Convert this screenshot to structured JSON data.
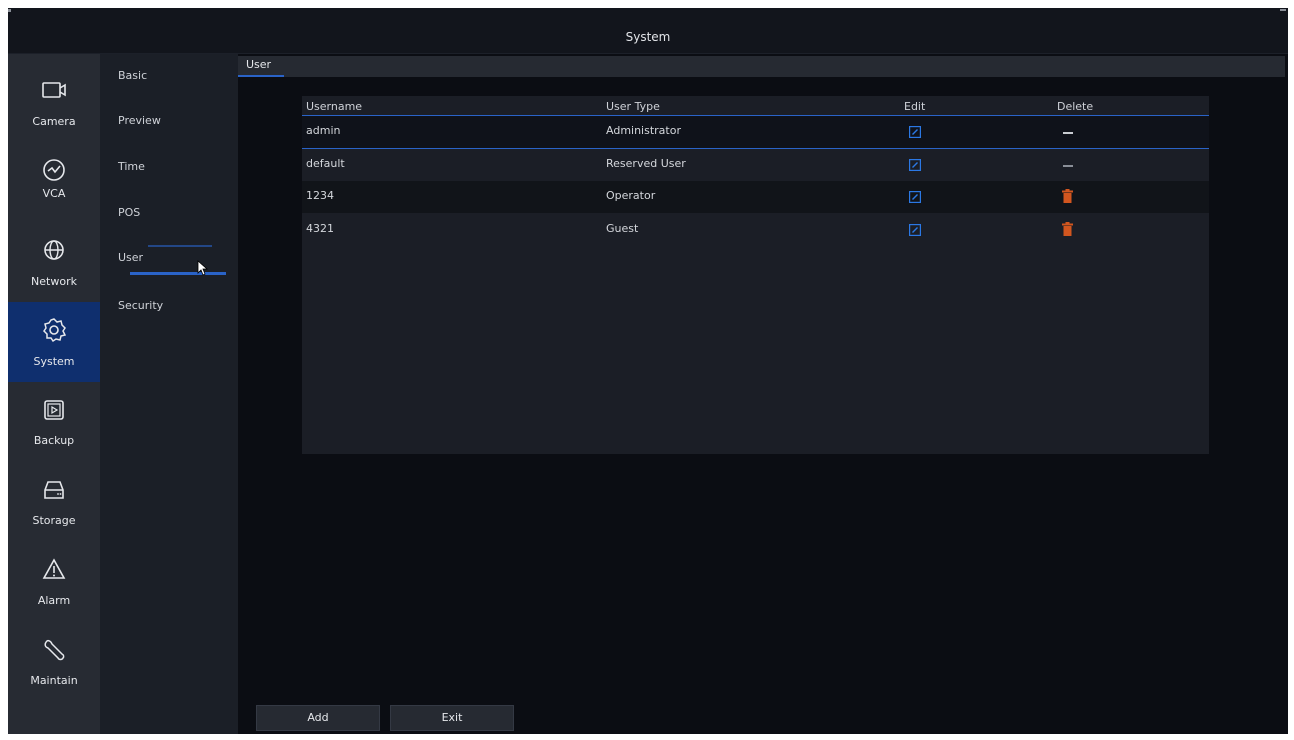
{
  "window": {
    "title": "System"
  },
  "nav": [
    {
      "label": "Camera",
      "icon": "camera-icon"
    },
    {
      "label": "VCA",
      "icon": "vca-icon"
    },
    {
      "label": "Network",
      "icon": "network-globe-icon"
    },
    {
      "label": "System",
      "icon": "gear-icon",
      "active": true
    },
    {
      "label": "Backup",
      "icon": "backup-icon"
    },
    {
      "label": "Storage",
      "icon": "storage-icon"
    },
    {
      "label": "Alarm",
      "icon": "alarm-warning-icon"
    },
    {
      "label": "Maintain",
      "icon": "wrench-icon"
    }
  ],
  "submenu": [
    "Basic",
    "Preview",
    "Time",
    "POS",
    "User",
    "Security"
  ],
  "submenu_selected": "User",
  "tab": {
    "label": "User"
  },
  "table": {
    "headers": [
      "Username",
      "User Type",
      "Edit",
      "Delete"
    ],
    "rows": [
      {
        "username": "admin",
        "type": "Administrator",
        "deletable": false
      },
      {
        "username": "default",
        "type": "Reserved User",
        "deletable": false
      },
      {
        "username": "1234",
        "type": "Operator",
        "deletable": true
      },
      {
        "username": "4321",
        "type": "Guest",
        "deletable": true
      }
    ]
  },
  "buttons": {
    "add": "Add",
    "exit": "Exit"
  },
  "colors": {
    "accent": "#2a63c8",
    "active_nav": "#0f2f6e",
    "delete": "#d2561f"
  }
}
